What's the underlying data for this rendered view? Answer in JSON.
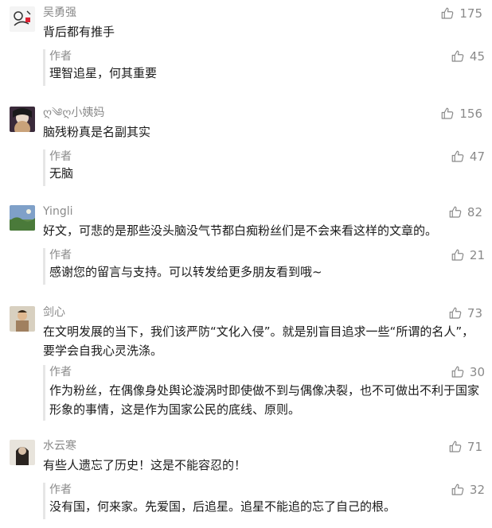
{
  "icons": {
    "like": "thumbs-up-icon"
  },
  "colors": {
    "meta_text": "#8a8a8a",
    "reply_bar": "#e6e6e6"
  },
  "comments": [
    {
      "username": "吴勇强",
      "text": "背后都有推手",
      "likes": "175",
      "reply": {
        "author": "作者",
        "text": "理智追星，何其重要",
        "likes": "45"
      }
    },
    {
      "username": "ღ༄ღ小姨妈",
      "text": "脑残粉真是名副其实",
      "likes": "156",
      "reply": {
        "author": "作者",
        "text": "无脑",
        "likes": "47"
      }
    },
    {
      "username": "Yingli",
      "text": "好文，可悲的是那些没头脑没气节都白痴粉丝们是不会来看这样的文章的。",
      "likes": "82",
      "reply": {
        "author": "作者",
        "text": "感谢您的留言与支持。可以转发给更多朋友看到哦~",
        "likes": "21"
      }
    },
    {
      "username": "剑心",
      "text": "在文明发展的当下，我们该严防“文化入侵”。就是别盲目追求一些“所谓的名人”，要学会自我心灵洗涤。",
      "likes": "73",
      "reply": {
        "author": "作者",
        "text": "作为粉丝，在偶像身处舆论漩涡时即使做不到与偶像决裂，也不可做出不利于国家形象的事情，这是作为国家公民的底线、原则。",
        "likes": "30"
      }
    },
    {
      "username": "水云寒",
      "text": "有些人遗忘了历史！这是不能容忍的！",
      "likes": "71",
      "reply": {
        "author": "作者",
        "text": "没有国，何来家。先爱国，后追星。追星不能追的忘了自己的根。",
        "likes": "32"
      }
    }
  ]
}
